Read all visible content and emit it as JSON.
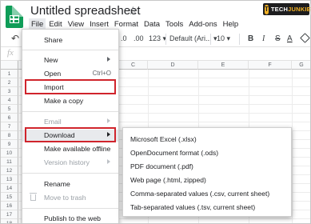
{
  "header": {
    "title": "Untitled spreadsheet",
    "star_icon": "star-icon",
    "menus": [
      "File",
      "Edit",
      "View",
      "Insert",
      "Format",
      "Data",
      "Tools",
      "Add-ons",
      "Help"
    ],
    "active_menu": "File"
  },
  "brand": {
    "letter": "T",
    "text_a": "TECH",
    "text_b": "JUNKIE"
  },
  "toolbar": {
    "decimal_less": ".0",
    "decimal_more": ".00",
    "number_format": "123",
    "font": "Default (Ari...",
    "font_size": "10",
    "bold": "B",
    "italic": "I",
    "strike": "S",
    "text_color": "A"
  },
  "formula_bar": {
    "fx": "fx"
  },
  "columns": [
    "C",
    "D",
    "E",
    "F",
    "G"
  ],
  "rows": [
    "1",
    "2",
    "3",
    "4",
    "5",
    "6",
    "7",
    "8",
    "9",
    "10",
    "11",
    "12",
    "13",
    "14",
    "15",
    "16",
    "17",
    "18"
  ],
  "file_menu": {
    "share": "Share",
    "new": "New",
    "open": "Open",
    "open_shortcut": "Ctrl+O",
    "import": "Import",
    "make_copy": "Make a copy",
    "email": "Email",
    "download": "Download",
    "make_offline": "Make available offline",
    "version_history": "Version history",
    "rename": "Rename",
    "move_trash": "Move to trash",
    "publish": "Publish to the web"
  },
  "download_menu": [
    "Microsoft Excel (.xlsx)",
    "OpenDocument format (.ods)",
    "PDF document (.pdf)",
    "Web page (.html, zipped)",
    "Comma-separated values (.csv, current sheet)",
    "Tab-separated values (.tsv, current sheet)"
  ],
  "colors": {
    "highlight_box": "#d0242c",
    "logo_green": "#0f9d58"
  }
}
